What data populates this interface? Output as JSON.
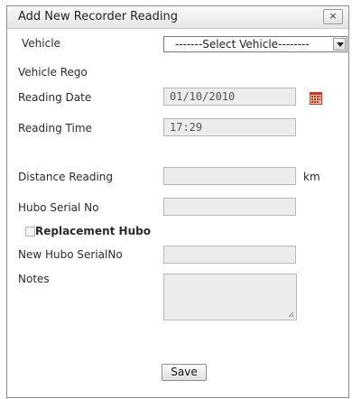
{
  "dialog": {
    "title": "Add New Recorder Reading",
    "close_label": "×"
  },
  "form": {
    "vehicle_label": "Vehicle",
    "vehicle_select": "-------Select Vehicle--------",
    "vehicle_rego_label": "Vehicle Rego",
    "reading_date_label": "Reading Date",
    "reading_date_value": "01/10/2010",
    "reading_time_label": "Reading Time",
    "reading_time_value": "17:29",
    "distance_label": "Distance Reading",
    "distance_value": "",
    "distance_unit": "km",
    "hubo_serial_label": "Hubo Serial No",
    "hubo_serial_value": "",
    "replacement_label": "Replacement Hubo",
    "new_hubo_label": "New Hubo SerialNo",
    "new_hubo_value": "",
    "notes_label": "Notes",
    "notes_value": "",
    "save_label": "Save"
  },
  "colors": {
    "field_bg": "#ececec",
    "field_border": "#b8b8b8",
    "calendar_accent": "#c0392b"
  }
}
